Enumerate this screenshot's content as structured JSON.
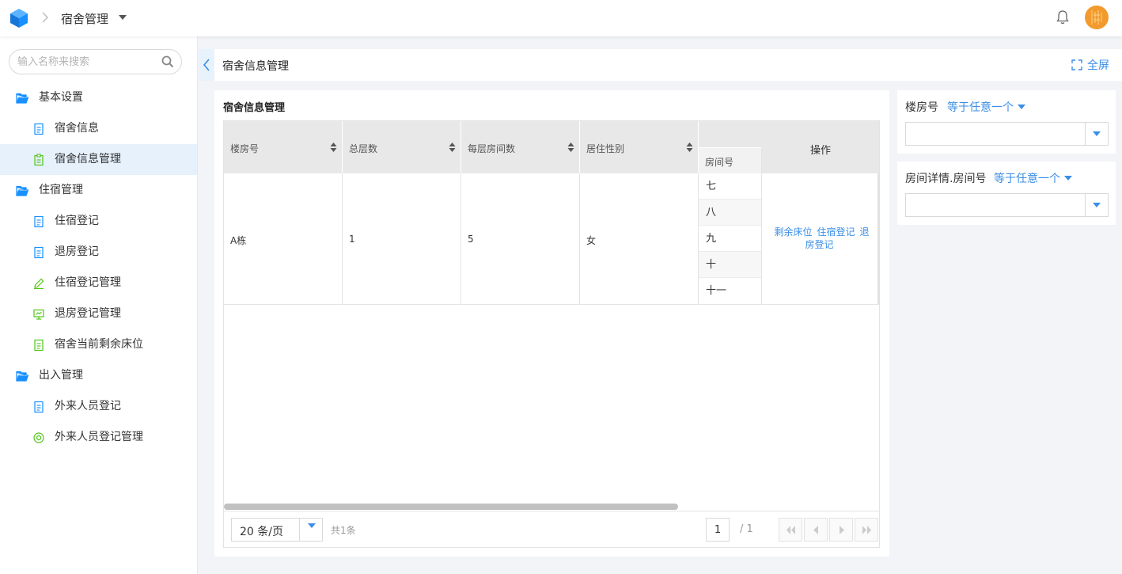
{
  "header": {
    "app_title": "宿舍管理",
    "colors": {
      "brand": "#1890ff",
      "avatar": "#f39a2d"
    }
  },
  "sidebar": {
    "search_placeholder": "输入名称来搜索",
    "items": [
      {
        "label": "基本设置",
        "type": "group",
        "icon": "folder-open-icon"
      },
      {
        "label": "宿舍信息",
        "type": "child",
        "icon": "document-icon"
      },
      {
        "label": "宿舍信息管理",
        "type": "child",
        "icon": "clipboard-icon",
        "active": true
      },
      {
        "label": "住宿管理",
        "type": "group",
        "icon": "folder-open-icon"
      },
      {
        "label": "住宿登记",
        "type": "child",
        "icon": "document-icon"
      },
      {
        "label": "退房登记",
        "type": "child",
        "icon": "document-icon"
      },
      {
        "label": "住宿登记管理",
        "type": "child",
        "icon": "edit-icon"
      },
      {
        "label": "退房登记管理",
        "type": "child",
        "icon": "monitor-icon"
      },
      {
        "label": "宿舍当前剩余床位",
        "type": "child",
        "icon": "document-icon"
      },
      {
        "label": "出入管理",
        "type": "group",
        "icon": "folder-open-icon"
      },
      {
        "label": "外来人员登记",
        "type": "child",
        "icon": "document-icon"
      },
      {
        "label": "外来人员登记管理",
        "type": "child",
        "icon": "target-icon"
      }
    ]
  },
  "main": {
    "page_title": "宿舍信息管理",
    "fullscreen_label": "全屏",
    "card_title": "宿舍信息管理",
    "table": {
      "columns": [
        "楼房号",
        "总层数",
        "每层房间数",
        "居住性别"
      ],
      "room_column": "房间号",
      "action_column": "操作",
      "rows": [
        {
          "building": "A栋",
          "floors": "1",
          "rooms_per_floor": "5",
          "gender": "女",
          "rooms": [
            "七",
            "八",
            "九",
            "十",
            "十一"
          ],
          "actions": [
            "剩余床位",
            "住宿登记",
            "退房登记"
          ]
        }
      ]
    },
    "pager": {
      "page_size": "20 条/页",
      "total": "共1条",
      "current_page": "1",
      "page_of": "/ 1"
    }
  },
  "filters": [
    {
      "label": "楼房号",
      "operator": "等于任意一个"
    },
    {
      "label": "房间详情.房间号",
      "operator": "等于任意一个"
    }
  ]
}
